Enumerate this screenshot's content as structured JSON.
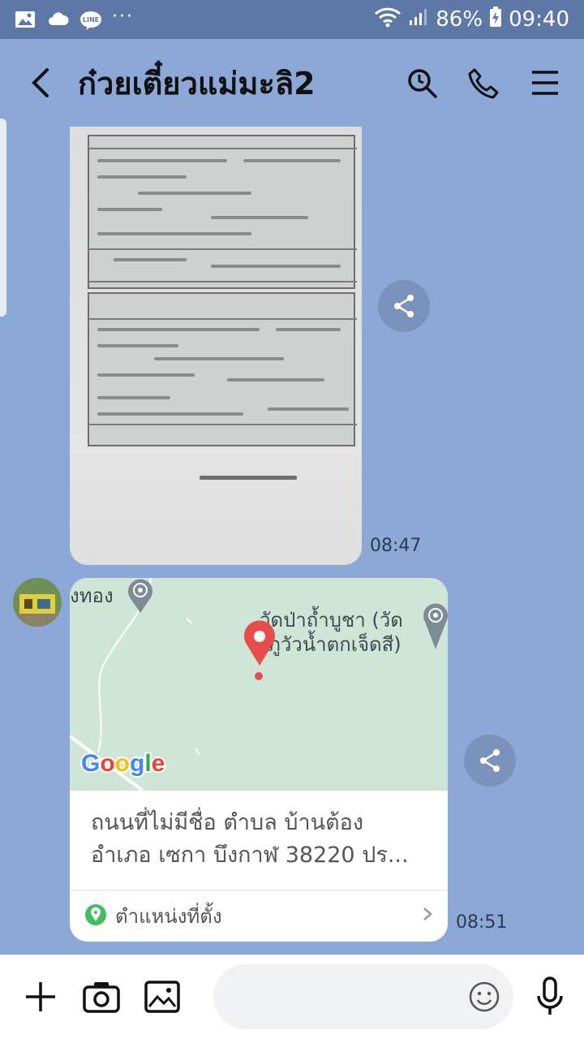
{
  "status_bar": {
    "battery": "86%",
    "time": "09:40",
    "notification_icons": [
      "gallery-icon",
      "cloud-icon",
      "line-app-icon",
      "more-dots-icon"
    ],
    "line_badge": "LINE",
    "dots": "···"
  },
  "header": {
    "title": "ก๋วยเตี๋ยวแม่มะลิ2",
    "actions": [
      "search-icon",
      "phone-icon",
      "menu-icon"
    ]
  },
  "messages": [
    {
      "type": "photo",
      "time": "08:47"
    },
    {
      "type": "location",
      "map": {
        "label_left": "งทอง",
        "label_temple_line1": "วัดป่าถ้ำบูชา (วัด",
        "label_temple_line2": "ภูวัวน้ำตกเจ็ดสี)",
        "logo": "Google"
      },
      "address_line1": "ถนนที่ไม่มีชื่อ ตำบล บ้านต้อง",
      "address_line2": "อำเภอ เซกา บึงกาฬ 38220 ปร...",
      "footer_label": "ตำแหน่งที่ตั้ง",
      "time": "08:51"
    }
  ],
  "composer": {
    "placeholder": ""
  },
  "colors": {
    "chat_background": "#8ba8d6",
    "status_bar": "#5d77a6",
    "location_pin": "#e84c4c",
    "location_green": "#3fbf5e"
  }
}
